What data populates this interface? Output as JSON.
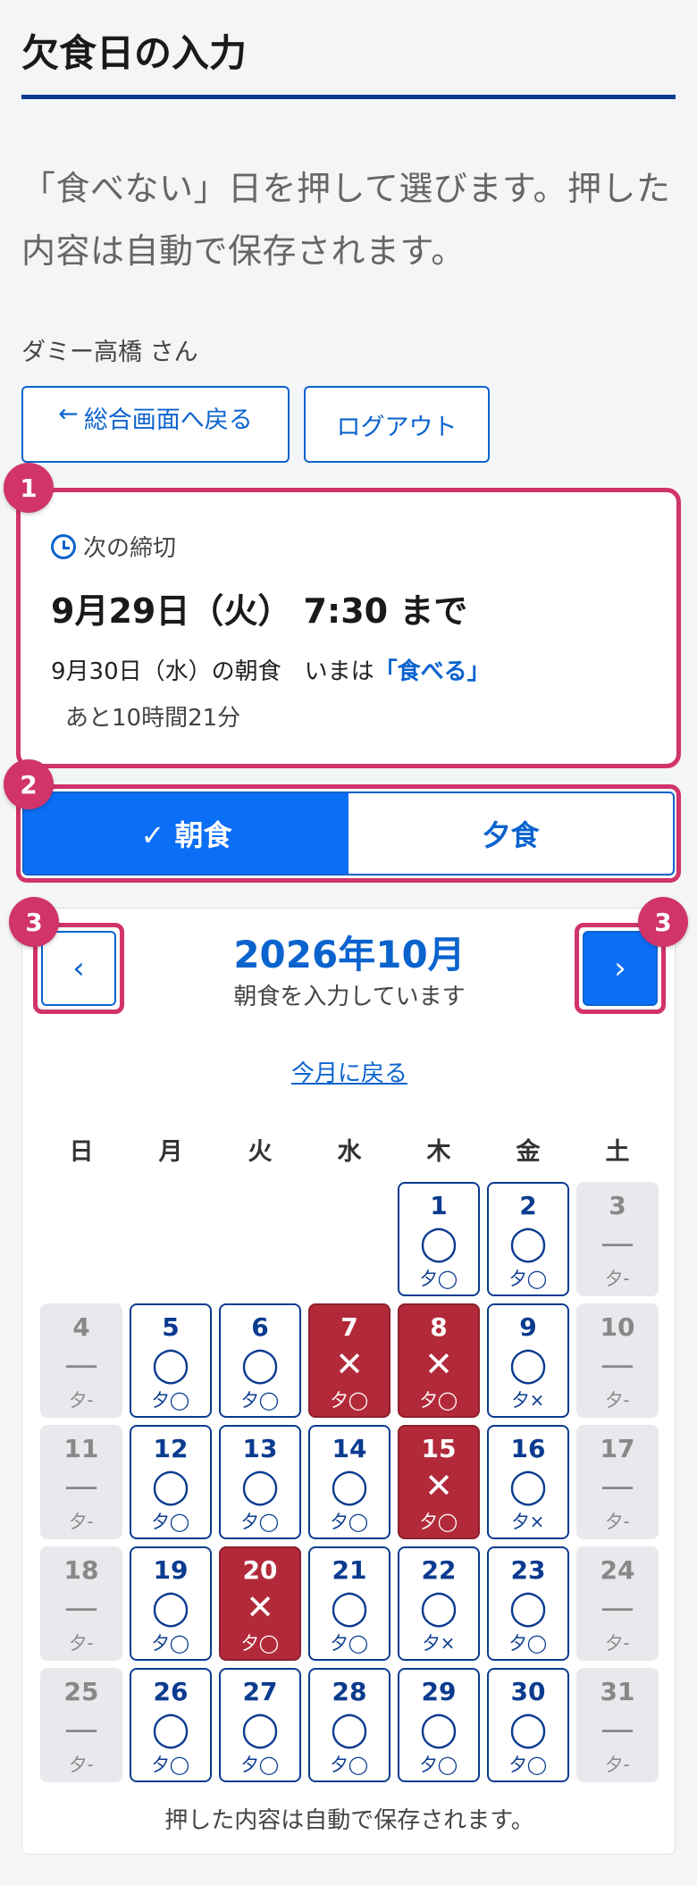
{
  "page": {
    "title": "欠食日の入力",
    "intro": "「食べない」日を押して選びます。押した内容は自動で保存されます。",
    "user": "ダミー高橋 さん"
  },
  "buttons": {
    "back_arrow": "←",
    "back": "総合画面へ戻る",
    "logout": "ログアウト"
  },
  "steps": [
    "1",
    "2",
    "3"
  ],
  "deadline": {
    "label": "次の締切",
    "time": "9月29日（火） 7:30 まで",
    "meal_prefix": "9月30日（水）の朝食　いまは",
    "status": "「食べる」",
    "remaining": "あと10時間21分"
  },
  "meal_tabs": [
    {
      "label": "✓ 朝食",
      "active": true
    },
    {
      "label": "夕食",
      "active": false
    }
  ],
  "calendar": {
    "prev_label": "‹",
    "next_label": "›",
    "month": "2026年10月",
    "subtitle": "朝食を入力しています",
    "today_link": "今月に戻る",
    "weekdays": [
      "日",
      "月",
      "火",
      "水",
      "木",
      "金",
      "土"
    ],
    "first_weekday": 4,
    "days": [
      {
        "d": "1",
        "mark": "◯",
        "ev": "夕◯",
        "state": "on"
      },
      {
        "d": "2",
        "mark": "◯",
        "ev": "夕◯",
        "state": "on"
      },
      {
        "d": "3",
        "mark": "—",
        "ev": "夕-",
        "state": "off"
      },
      {
        "d": "4",
        "mark": "—",
        "ev": "夕-",
        "state": "off"
      },
      {
        "d": "5",
        "mark": "◯",
        "ev": "夕◯",
        "state": "on"
      },
      {
        "d": "6",
        "mark": "◯",
        "ev": "夕◯",
        "state": "on"
      },
      {
        "d": "7",
        "mark": "✕",
        "ev": "夕◯",
        "state": "skip"
      },
      {
        "d": "8",
        "mark": "✕",
        "ev": "夕◯",
        "state": "skip"
      },
      {
        "d": "9",
        "mark": "◯",
        "ev": "夕×",
        "state": "on"
      },
      {
        "d": "10",
        "mark": "—",
        "ev": "夕-",
        "state": "off"
      },
      {
        "d": "11",
        "mark": "—",
        "ev": "夕-",
        "state": "off"
      },
      {
        "d": "12",
        "mark": "◯",
        "ev": "夕◯",
        "state": "on"
      },
      {
        "d": "13",
        "mark": "◯",
        "ev": "夕◯",
        "state": "on"
      },
      {
        "d": "14",
        "mark": "◯",
        "ev": "夕◯",
        "state": "on"
      },
      {
        "d": "15",
        "mark": "✕",
        "ev": "夕◯",
        "state": "skip"
      },
      {
        "d": "16",
        "mark": "◯",
        "ev": "夕×",
        "state": "on"
      },
      {
        "d": "17",
        "mark": "—",
        "ev": "夕-",
        "state": "off"
      },
      {
        "d": "18",
        "mark": "—",
        "ev": "夕-",
        "state": "off"
      },
      {
        "d": "19",
        "mark": "◯",
        "ev": "夕◯",
        "state": "on"
      },
      {
        "d": "20",
        "mark": "✕",
        "ev": "夕◯",
        "state": "skip"
      },
      {
        "d": "21",
        "mark": "◯",
        "ev": "夕◯",
        "state": "on"
      },
      {
        "d": "22",
        "mark": "◯",
        "ev": "夕×",
        "state": "on"
      },
      {
        "d": "23",
        "mark": "◯",
        "ev": "夕◯",
        "state": "on"
      },
      {
        "d": "24",
        "mark": "—",
        "ev": "夕-",
        "state": "off"
      },
      {
        "d": "25",
        "mark": "—",
        "ev": "夕-",
        "state": "off"
      },
      {
        "d": "26",
        "mark": "◯",
        "ev": "夕◯",
        "state": "on"
      },
      {
        "d": "27",
        "mark": "◯",
        "ev": "夕◯",
        "state": "on"
      },
      {
        "d": "28",
        "mark": "◯",
        "ev": "夕◯",
        "state": "on"
      },
      {
        "d": "29",
        "mark": "◯",
        "ev": "夕◯",
        "state": "on"
      },
      {
        "d": "30",
        "mark": "◯",
        "ev": "夕◯",
        "state": "on"
      },
      {
        "d": "31",
        "mark": "—",
        "ev": "夕-",
        "state": "off"
      }
    ],
    "footer": "押した内容は自動で保存されます。"
  },
  "colors": {
    "primary": "#0b6ef6",
    "navy": "#0a3b8f",
    "highlight": "#d1336b",
    "skip": "#b22a3a",
    "disabled": "#e7e9ec"
  }
}
